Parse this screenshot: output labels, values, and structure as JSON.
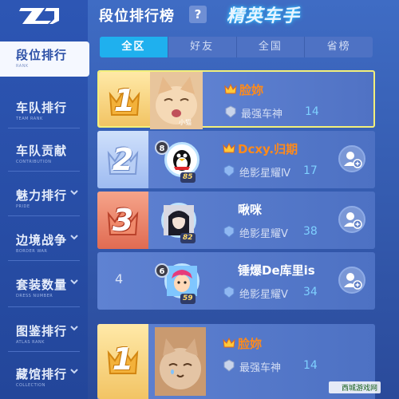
{
  "header": {
    "title": "段位排行榜",
    "help": "?",
    "brand": "精英车手"
  },
  "sidebar": {
    "items": [
      {
        "label": "段位排行",
        "sub": "RANK",
        "active": true,
        "has_arrow": false
      },
      {
        "label": "车队排行",
        "sub": "TEAM RANK",
        "active": false,
        "has_arrow": false
      },
      {
        "label": "车队贡献",
        "sub": "CONTRIBUTION",
        "active": false,
        "has_arrow": false
      },
      {
        "label": "魅力排行",
        "sub": "PRIDE",
        "active": false,
        "has_arrow": true
      },
      {
        "label": "边境战争",
        "sub": "BORDER WAR",
        "active": false,
        "has_arrow": true
      },
      {
        "label": "套装数量",
        "sub": "DRESS NUMBER",
        "active": false,
        "has_arrow": true
      },
      {
        "label": "图鉴排行",
        "sub": "ATLAS RANK",
        "active": false,
        "has_arrow": true
      },
      {
        "label": "藏馆排行",
        "sub": "COLLECTION",
        "active": false,
        "has_arrow": true
      }
    ]
  },
  "tabs": [
    {
      "label": "全区",
      "active": true
    },
    {
      "label": "好友",
      "active": false
    },
    {
      "label": "全国",
      "active": false
    },
    {
      "label": "省榜",
      "active": false
    }
  ],
  "rows": [
    {
      "rank": "1",
      "name": "脸妳",
      "rank_name": "最强车神",
      "rank_level": "14",
      "photo_caption": "小猫"
    },
    {
      "rank": "2",
      "name": "Dcxy.归期",
      "rank_name": "绝影星耀Ⅳ",
      "rank_level": "17",
      "player_level": "8",
      "score": "85"
    },
    {
      "rank": "3",
      "name": "啾咪",
      "rank_name": "绝影星耀Ⅴ",
      "rank_level": "38",
      "score": "82"
    },
    {
      "rank": "4",
      "name": "锤爆De库里is",
      "rank_name": "绝影星耀Ⅴ",
      "rank_level": "34",
      "player_level": "6",
      "score": "59"
    },
    {
      "rank": "1",
      "name": "脸妳",
      "rank_name": "最强车神",
      "rank_level": "14"
    }
  ],
  "watermark": "西城游戏网",
  "colors": {
    "accent_tab": "#1fb0ee",
    "highlight_border": "#f3f07a",
    "name_orange": "#ff8a1a",
    "level_blue": "#7ed0ff"
  }
}
